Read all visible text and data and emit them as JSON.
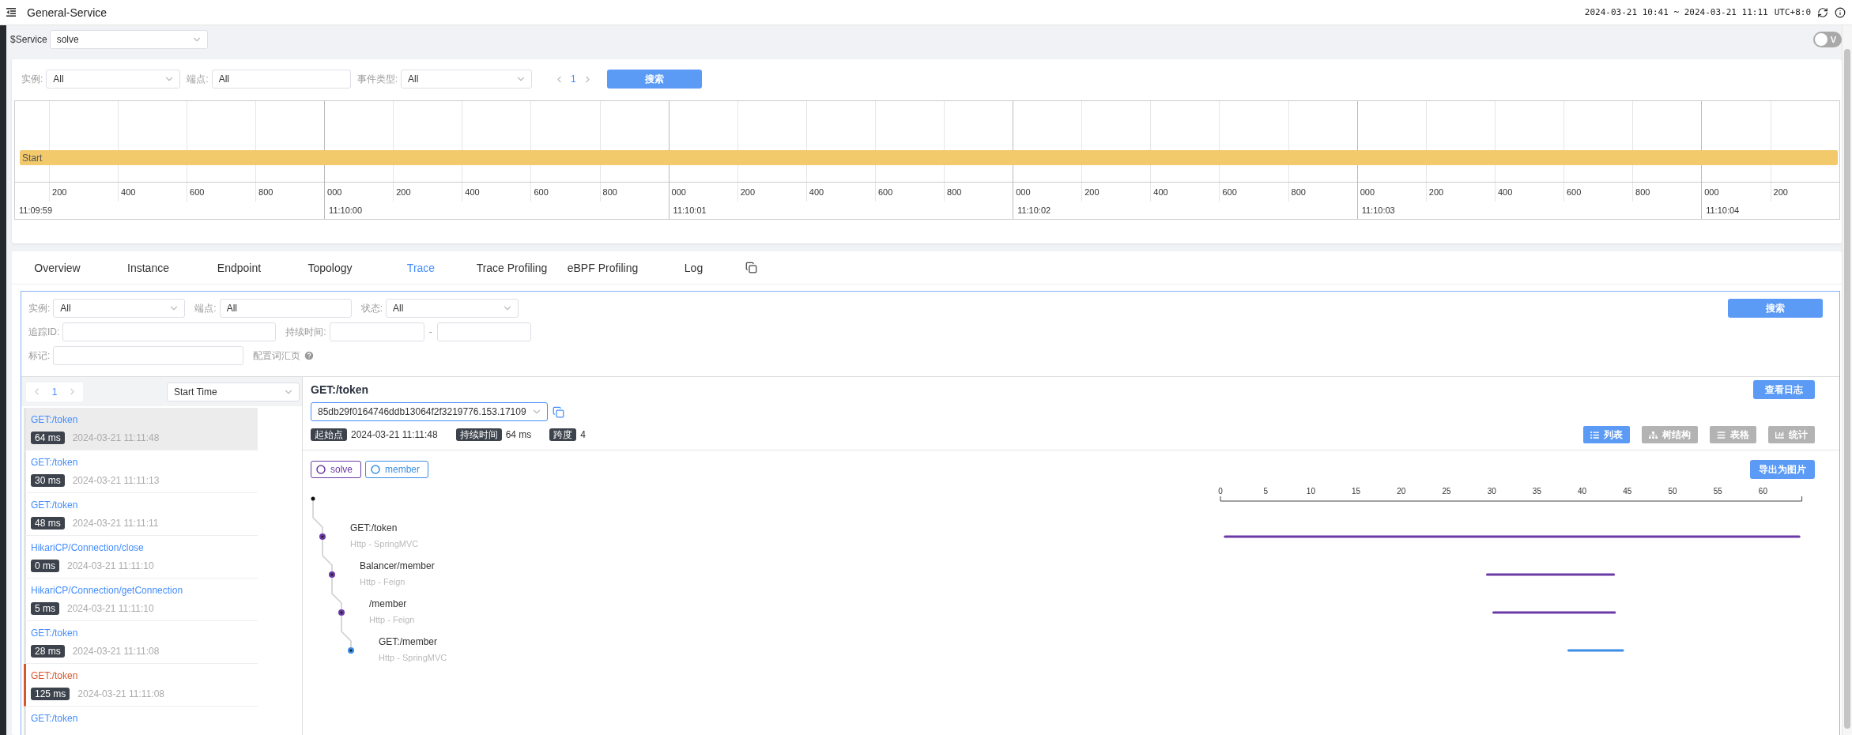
{
  "header": {
    "title": "General-Service",
    "time_range": "2024-03-21 10:41 ~ 2024-03-21 11:11",
    "timezone": "UTC+8:0"
  },
  "service_bar": {
    "label": "$Service",
    "value": "solve",
    "toggle": {
      "label": "V",
      "on": false
    }
  },
  "event_filters": {
    "fields": [
      {
        "kind": "select",
        "label": "实例:",
        "value": "All"
      },
      {
        "kind": "input",
        "label": "端点:",
        "value": "All"
      },
      {
        "kind": "select",
        "label": "事件类型:",
        "value": "All"
      }
    ],
    "page": "1",
    "search_button": "搜索"
  },
  "timeline": {
    "bar_label": "Start",
    "segments": [
      {
        "time": "11:09:59",
        "ticks": [
          "200",
          "400",
          "600",
          "800"
        ]
      },
      {
        "time": "11:10:00",
        "ticks": [
          "000",
          "200",
          "400",
          "600",
          "800"
        ]
      },
      {
        "time": "11:10:01",
        "ticks": [
          "000",
          "200",
          "400",
          "600",
          "800"
        ]
      },
      {
        "time": "11:10:02",
        "ticks": [
          "000",
          "200",
          "400",
          "600",
          "800"
        ]
      },
      {
        "time": "11:10:03",
        "ticks": [
          "000",
          "200",
          "400",
          "600",
          "800"
        ]
      },
      {
        "time": "11:10:04",
        "ticks": [
          "000",
          "200"
        ]
      }
    ]
  },
  "tabs": [
    {
      "label": "Overview",
      "selected": false
    },
    {
      "label": "Instance",
      "selected": false
    },
    {
      "label": "Endpoint",
      "selected": false
    },
    {
      "label": "Topology",
      "selected": false
    },
    {
      "label": "Trace",
      "selected": true
    },
    {
      "label": "Trace Profiling",
      "selected": false
    },
    {
      "label": "eBPF Profiling",
      "selected": false
    },
    {
      "label": "Log",
      "selected": false
    }
  ],
  "trace_filters": {
    "rows": [
      [
        {
          "kind": "select",
          "label": "实例:",
          "value": "All"
        },
        {
          "kind": "input",
          "label": "端点:",
          "value": "All"
        },
        {
          "kind": "select",
          "label": "状态:",
          "value": "All"
        }
      ],
      [
        {
          "kind": "input",
          "label": "追踪ID:"
        },
        {
          "kind": "range",
          "label": "持续时间:",
          "separator": "-"
        }
      ],
      [
        {
          "kind": "input",
          "label": "标记:"
        },
        {
          "kind": "help",
          "label": "配置词汇页"
        }
      ]
    ],
    "search_button": "搜索"
  },
  "trace_list": {
    "page": "1",
    "sort": "Start Time",
    "items": [
      {
        "title": "GET:/token",
        "duration": "64 ms",
        "time": "2024-03-21 11:11:48",
        "selected": true,
        "error": false
      },
      {
        "title": "GET:/token",
        "duration": "30 ms",
        "time": "2024-03-21 11:11:13",
        "selected": false,
        "error": false
      },
      {
        "title": "GET:/token",
        "duration": "48 ms",
        "time": "2024-03-21 11:11:11",
        "selected": false,
        "error": false
      },
      {
        "title": "HikariCP/Connection/close",
        "duration": "0 ms",
        "time": "2024-03-21 11:11:10",
        "selected": false,
        "error": false
      },
      {
        "title": "HikariCP/Connection/getConnection",
        "duration": "5 ms",
        "time": "2024-03-21 11:11:10",
        "selected": false,
        "error": false
      },
      {
        "title": "GET:/token",
        "duration": "28 ms",
        "time": "2024-03-21 11:11:08",
        "selected": false,
        "error": false
      },
      {
        "title": "GET:/token",
        "duration": "125 ms",
        "time": "2024-03-21 11:11:08",
        "selected": false,
        "error": true
      },
      {
        "title": "GET:/token",
        "selected": false,
        "error": false
      }
    ]
  },
  "detail": {
    "title": "GET:/token",
    "log_button": "查看日志",
    "trace_id": "85db29f0164746ddb13064f2f3219776.153.17109",
    "start_label": "起始点",
    "start": "2024-03-21 11:11:48",
    "duration_label": "持续时间",
    "duration": "64 ms",
    "span_label": "跨度",
    "spans": "4",
    "views": [
      {
        "kind": "list",
        "label": "列表",
        "selected": true
      },
      {
        "kind": "tree",
        "label": "树结构",
        "selected": false
      },
      {
        "kind": "table",
        "label": "表格",
        "selected": false
      },
      {
        "kind": "statistics",
        "label": "统计",
        "selected": false
      }
    ],
    "services": [
      {
        "name": "solve",
        "color": "#6b3aa6"
      },
      {
        "name": "member",
        "color": "#3a8ee6"
      }
    ],
    "export_button": "导出为图片",
    "tree": {
      "children": [
        {
          "name": "GET:/token",
          "component": "Http - SpringMVC",
          "color": "#6b3aa6",
          "children": [
            {
              "name": "Balancer/member",
              "component": "Http - Feign",
              "color": "#6b3aa6",
              "children": [
                {
                  "name": "/member",
                  "component": "Http - Feign",
                  "color": "#6b3aa6",
                  "children": [
                    {
                      "name": "GET:/member",
                      "component": "Http - SpringMVC",
                      "color": "#3a8ee6"
                    }
                  ]
                }
              ]
            }
          ]
        }
      ]
    },
    "axis_ticks": [
      "0",
      "5",
      "10",
      "15",
      "20",
      "25",
      "30",
      "35",
      "40",
      "45",
      "50",
      "55",
      "60"
    ]
  }
}
